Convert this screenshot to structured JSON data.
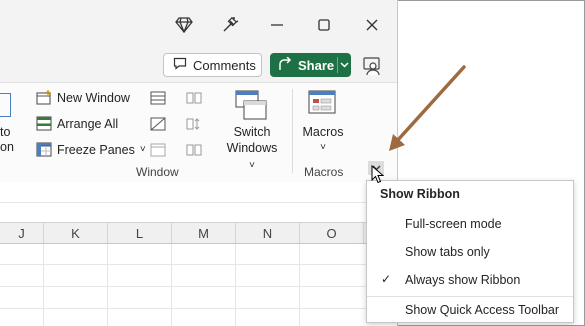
{
  "header": {
    "comments_label": "Comments",
    "share_label": "Share",
    "icons": [
      "diamond-icon",
      "magic-wand-icon",
      "minimize-icon",
      "restore-icon",
      "close-icon"
    ]
  },
  "ribbon": {
    "partial_left_text": "to\non",
    "new_window": "New Window",
    "arrange_all": "Arrange All",
    "freeze_panes": "Freeze Panes",
    "switch_windows_line1": "Switch",
    "switch_windows_line2": "Windows",
    "macros": "Macros",
    "group_window": "Window",
    "group_macros": "Macros",
    "dropdown_caret": "˅"
  },
  "grid": {
    "columns": [
      "J",
      "K",
      "L",
      "M",
      "N",
      "O"
    ]
  },
  "popup": {
    "title": "Show Ribbon",
    "items": [
      "Full-screen mode",
      "Show tabs only",
      "Always show Ribbon",
      "Show Quick Access Toolbar"
    ],
    "checked_index": 2,
    "check_mark": "✓"
  },
  "colors": {
    "share_green": "#1e7145",
    "arrow_brown": "#a06a3f",
    "window_bg": "#f3f3f3"
  }
}
